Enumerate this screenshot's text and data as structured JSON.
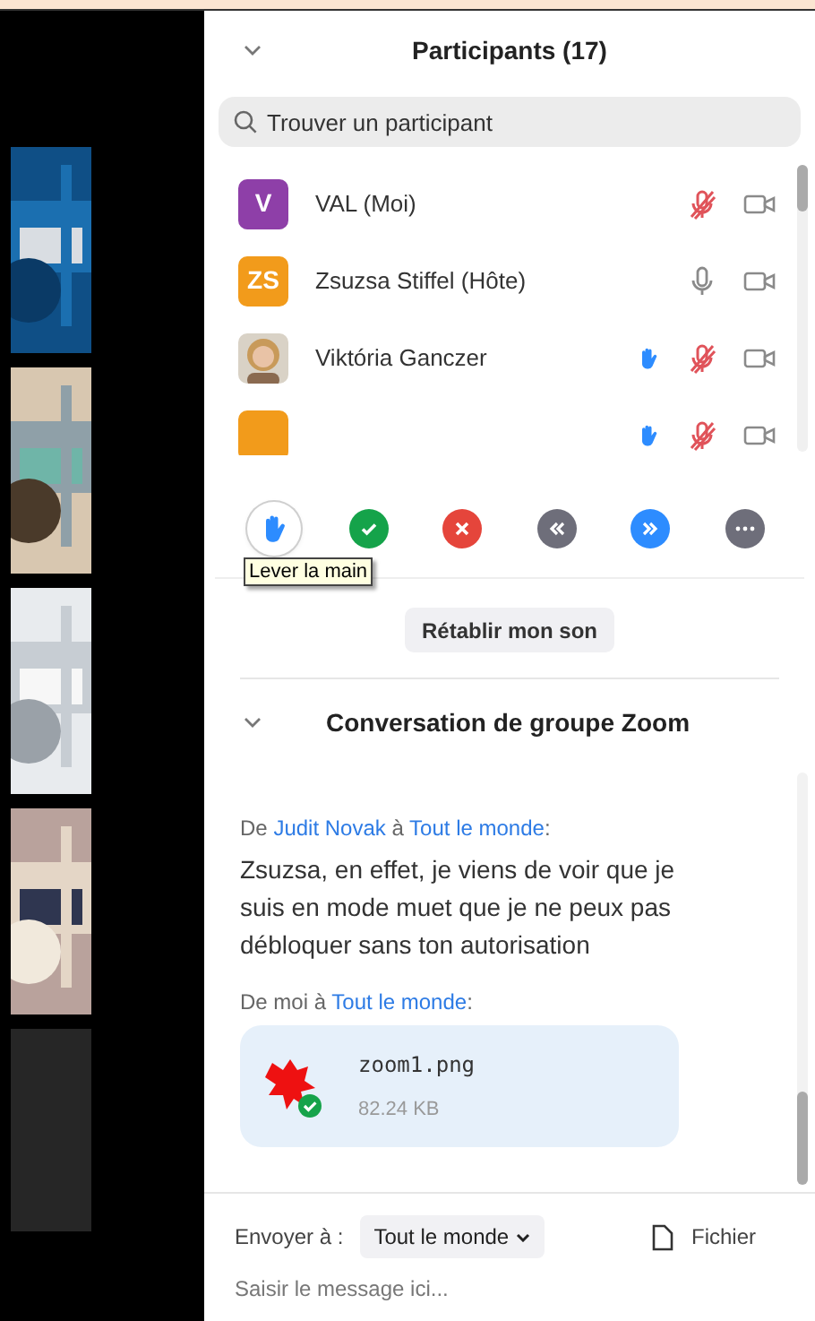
{
  "participants_panel": {
    "title": "Participants (17)",
    "search": {
      "placeholder": "Trouver un participant"
    },
    "participants": [
      {
        "name": "VAL (Moi)",
        "avatar": {
          "kind": "initials",
          "initials": "V",
          "color": "#8e3fa8"
        },
        "hand_raised": false,
        "muted": true
      },
      {
        "name": "Zsuzsa Stiffel (Hôte)",
        "avatar": {
          "kind": "initials",
          "initials": "ZS",
          "color": "#f29b1b"
        },
        "hand_raised": false,
        "muted": false
      },
      {
        "name": "Viktória Ganczer",
        "hand_raised": true,
        "muted": true
      },
      {
        "avatar": {
          "kind": "initials",
          "color": "#f29b1b"
        },
        "hand_raised": true,
        "muted": true
      }
    ],
    "actions": [
      {
        "kind": "hand",
        "tooltip": "Lever la main"
      },
      {
        "kind": "yes"
      },
      {
        "kind": "no"
      },
      {
        "kind": "slower"
      },
      {
        "kind": "faster"
      },
      {
        "kind": "more"
      }
    ],
    "unmute_button": "Rétablir mon son"
  },
  "chat": {
    "title": "Conversation de groupe Zoom",
    "messages": [
      {
        "kind": "text",
        "prefix": "De",
        "sender": "Judit Novak",
        "to_word": "à",
        "recipient": "Tout le monde",
        "colon": ":",
        "text": "Zsuzsa, en effet, je viens de voir que je suis en mode muet que je ne peux pas débloquer sans ton autorisation"
      },
      {
        "kind": "file",
        "prefix": "De moi",
        "to_word": "à",
        "recipient": "Tout le monde",
        "colon": ":",
        "file_name": "zoom1.png",
        "file_size": "82.24 KB"
      }
    ],
    "send_to_label": "Envoyer à :",
    "send_to_value": "Tout le monde",
    "file_button": "Fichier",
    "message_placeholder": "Saisir le message ici..."
  }
}
